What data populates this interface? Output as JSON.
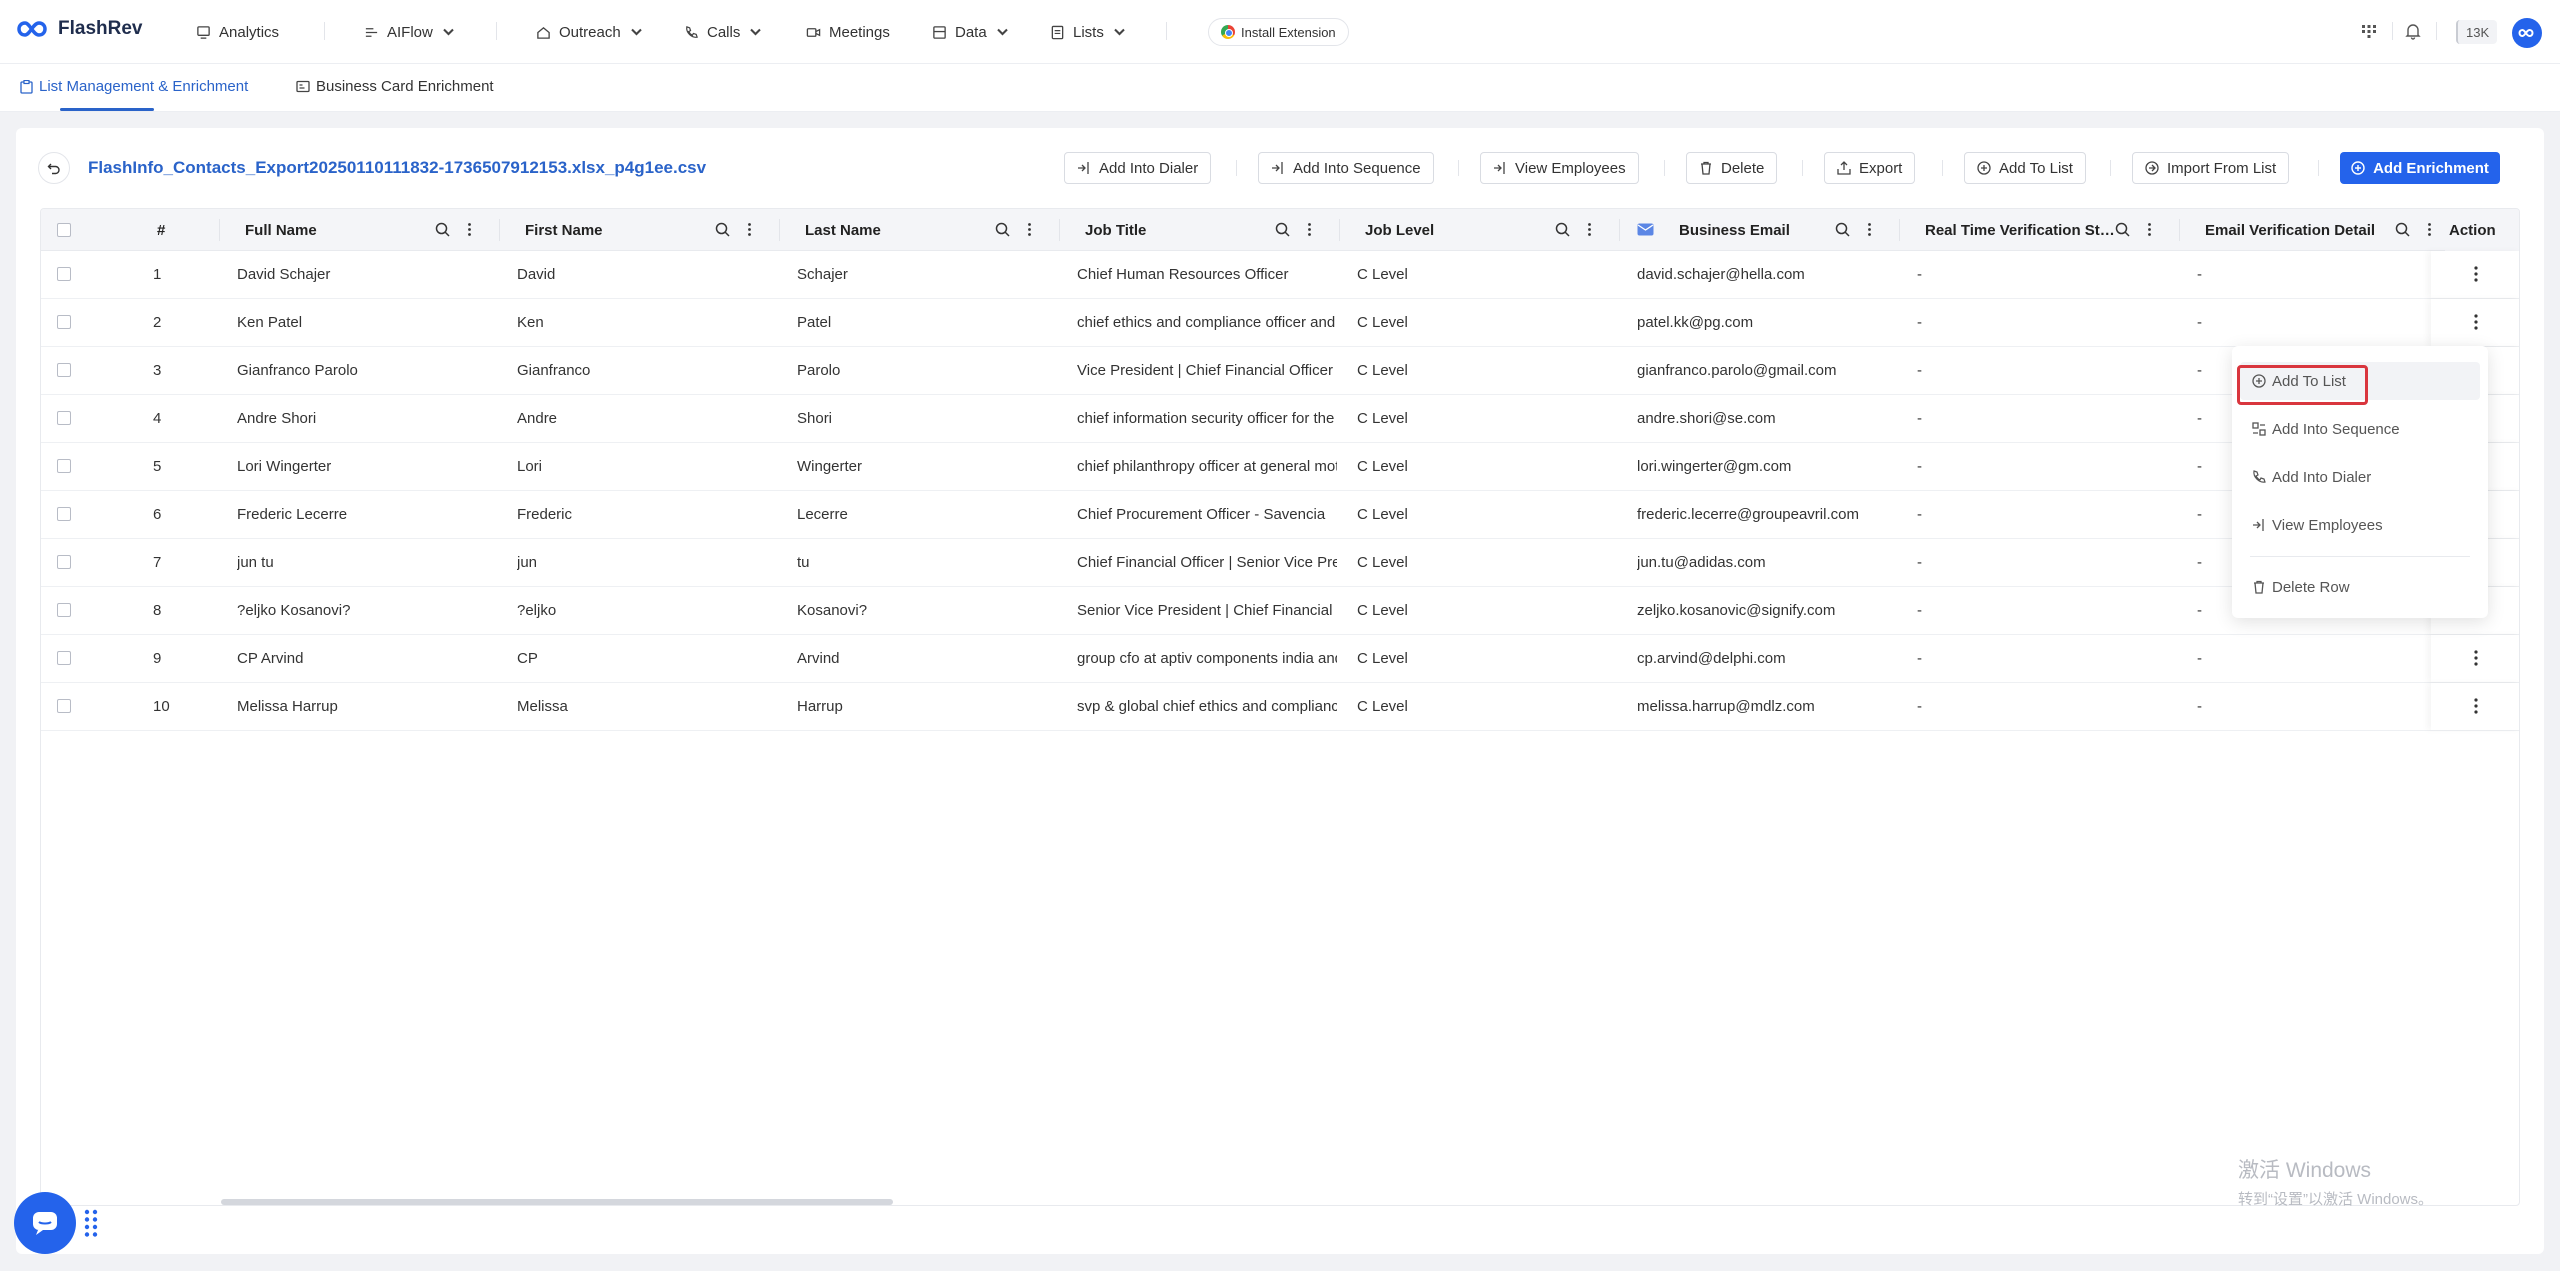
{
  "app": {
    "logo_text": "FlashRev"
  },
  "nav": {
    "items": [
      {
        "label": "Analytics",
        "icon": "analytics-icon"
      },
      {
        "label": "AIFlow",
        "icon": "flow-icon"
      },
      {
        "label": "Outreach",
        "icon": "outreach-icon"
      },
      {
        "label": "Calls",
        "icon": "phone-icon"
      },
      {
        "label": "Meetings",
        "icon": "meetings-icon"
      },
      {
        "label": "Data",
        "icon": "data-icon"
      },
      {
        "label": "Lists",
        "icon": "lists-icon"
      }
    ],
    "install_extension": "Install Extension",
    "credits": "13K"
  },
  "subtabs": [
    {
      "label": "List Management & Enrichment",
      "active": true
    },
    {
      "label": "Business Card Enrichment",
      "active": false
    }
  ],
  "file_title": "FlashInfo_Contacts_Export20250110111832-1736507912153.xlsx_p4g1ee.csv",
  "toolbar": {
    "add_into_dialer": "Add Into Dialer",
    "add_into_sequence": "Add Into Sequence",
    "view_employees": "View Employees",
    "delete": "Delete",
    "export": "Export",
    "add_to_list": "Add To List",
    "import_from_list": "Import From List",
    "add_enrichment": "Add Enrichment"
  },
  "table": {
    "headers": {
      "num": "#",
      "full_name": "Full Name",
      "first_name": "First Name",
      "last_name": "Last Name",
      "job_title": "Job Title",
      "job_level": "Job Level",
      "business_email": "Business Email",
      "rt_verification": "Real Time Verification St…",
      "email_verification": "Email Verification Detail",
      "action": "Action"
    },
    "rows": [
      {
        "num": "1",
        "full": "David Schajer",
        "first": "David",
        "last": "Schajer",
        "title": "Chief Human Resources Officer",
        "level": "C Level",
        "email": "david.schajer@hella.com",
        "rt": "-",
        "ev": "-"
      },
      {
        "num": "2",
        "full": "Ken Patel",
        "first": "Ken",
        "last": "Patel",
        "title": "chief ethics and compliance officer and c",
        "level": "C Level",
        "email": "patel.kk@pg.com",
        "rt": "-",
        "ev": "-"
      },
      {
        "num": "3",
        "full": "Gianfranco Parolo",
        "first": "Gianfranco",
        "last": "Parolo",
        "title": "Vice President | Chief Financial Officer | O",
        "level": "C Level",
        "email": "gianfranco.parolo@gmail.com",
        "rt": "-",
        "ev": "-"
      },
      {
        "num": "4",
        "full": "Andre Shori",
        "first": "Andre",
        "last": "Shori",
        "title": "chief information security officer for the a",
        "level": "C Level",
        "email": "andre.shori@se.com",
        "rt": "-",
        "ev": "-"
      },
      {
        "num": "5",
        "full": "Lori Wingerter",
        "first": "Lori",
        "last": "Wingerter",
        "title": "chief philanthropy officer at general moto",
        "level": "C Level",
        "email": "lori.wingerter@gm.com",
        "rt": "-",
        "ev": "-"
      },
      {
        "num": "6",
        "full": "Frederic Lecerre",
        "first": "Frederic",
        "last": "Lecerre",
        "title": "Chief Procurement Officer - Savencia",
        "level": "C Level",
        "email": "frederic.lecerre@groupeavril.com",
        "rt": "-",
        "ev": "-"
      },
      {
        "num": "7",
        "full": "jun tu",
        "first": "jun",
        "last": "tu",
        "title": "Chief Financial Officer | Senior Vice Presic",
        "level": "C Level",
        "email": "jun.tu@adidas.com",
        "rt": "-",
        "ev": "-"
      },
      {
        "num": "8",
        "full": "?eljko Kosanovi?",
        "first": "?eljko",
        "last": "Kosanovi?",
        "title": "Senior Vice President | Chief Financial Off",
        "level": "C Level",
        "email": "zeljko.kosanovic@signify.com",
        "rt": "-",
        "ev": "-"
      },
      {
        "num": "9",
        "full": "CP Arvind",
        "first": "CP",
        "last": "Arvind",
        "title": "group cfo at aptiv components india and",
        "level": "C Level",
        "email": "cp.arvind@delphi.com",
        "rt": "-",
        "ev": "-"
      },
      {
        "num": "10",
        "full": "Melissa Harrup",
        "first": "Melissa",
        "last": "Harrup",
        "title": "svp & global chief ethics and compliance",
        "level": "C Level",
        "email": "melissa.harrup@mdlz.com",
        "rt": "-",
        "ev": "-"
      }
    ]
  },
  "row_menu": {
    "add_to_list": "Add To List",
    "add_into_sequence": "Add Into Sequence",
    "add_into_dialer": "Add Into Dialer",
    "view_employees": "View Employees",
    "delete_row": "Delete Row"
  },
  "watermark": {
    "line1": "激活 Windows",
    "line2": "转到“设置”以激活 Windows。"
  },
  "colors": {
    "brand": "#2463eb",
    "link": "#2a63c9",
    "highlight": "#d9363e"
  }
}
